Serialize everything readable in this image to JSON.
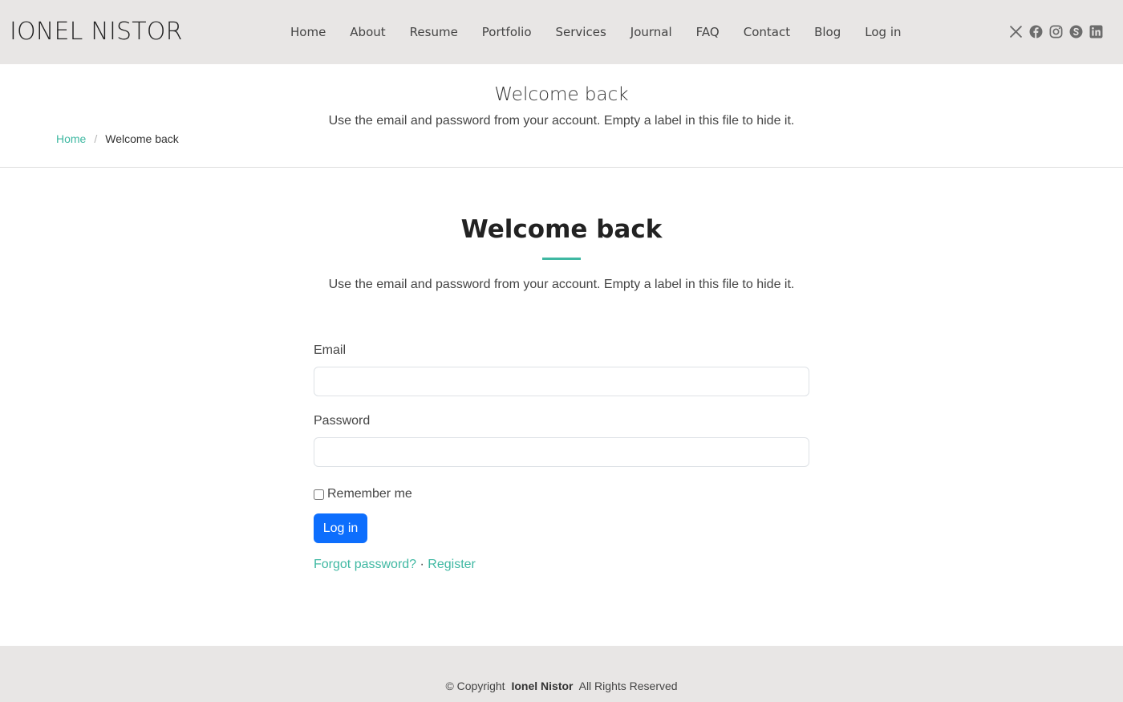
{
  "header": {
    "logo": "IONEL NISTOR",
    "nav": [
      "Home",
      "About",
      "Resume",
      "Portfolio",
      "Services",
      "Journal",
      "FAQ",
      "Contact",
      "Blog",
      "Log in"
    ],
    "social_icons": [
      "x-icon",
      "facebook-icon",
      "instagram-icon",
      "skype-icon",
      "linkedin-icon"
    ]
  },
  "page_title": {
    "title": "Welcome back",
    "subtitle": "Use the email and password from your account. Empty a label in this file to hide it."
  },
  "breadcrumb": {
    "home": "Home",
    "separator": "/",
    "current": "Welcome back"
  },
  "section": {
    "title": "Welcome back",
    "subtitle": "Use the email and password from your account. Empty a label in this file to hide it."
  },
  "form": {
    "email_label": "Email",
    "email_value": "",
    "password_label": "Password",
    "password_value": "",
    "remember_label": "Remember me",
    "remember_checked": false,
    "submit_label": "Log in",
    "forgot_label": "Forgot password?",
    "links_separator": "·",
    "register_label": "Register"
  },
  "footer": {
    "copyright_prefix": "© Copyright",
    "owner": "Ionel Nistor",
    "rights": "All Rights Reserved"
  },
  "colors": {
    "accent": "#3fb8a2",
    "primary_button": "#0d6efd",
    "header_bg": "#e8e6e5",
    "footer_bg": "#e8e6e5"
  }
}
